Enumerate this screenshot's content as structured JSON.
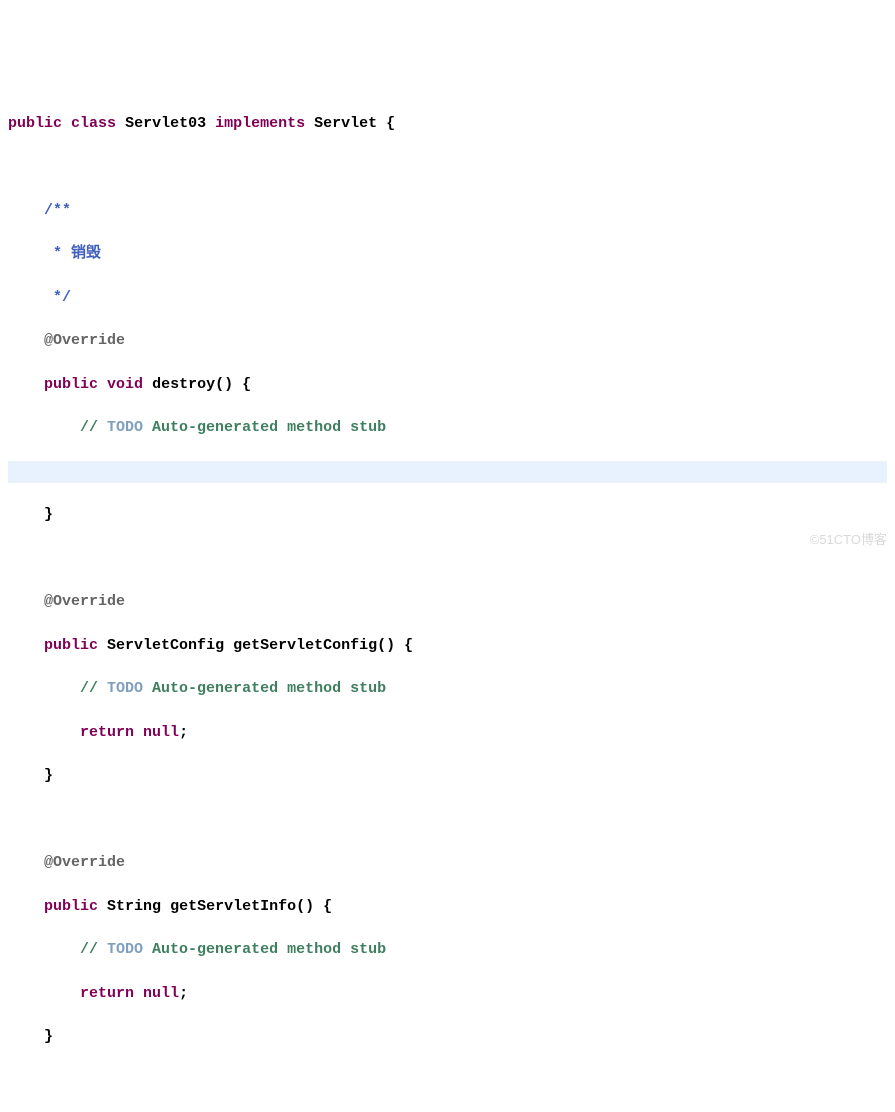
{
  "code": {
    "class_decl": {
      "kw_public": "public",
      "kw_class": "class",
      "class_name": "Servlet03",
      "kw_implements": "implements",
      "interface_name": "Servlet",
      "open_brace": " {"
    },
    "doc1": {
      "l1": "/**",
      "l2": " * 销毁",
      "l3": " */"
    },
    "override1": "@Override",
    "m1": {
      "kw_public": "public",
      "kw_void": "void",
      "name": "destroy",
      "parens": "()",
      "open": " {",
      "todo_prefix": "// ",
      "todo_kw": "TODO",
      "todo_rest": " Auto-generated method stub",
      "close": "}"
    },
    "override2": "@Override",
    "m2": {
      "kw_public": "public",
      "ret_type": "ServletConfig",
      "name": "getServletConfig",
      "parens": "()",
      "open": " {",
      "todo_prefix": "// ",
      "todo_kw": "TODO",
      "todo_rest": " Auto-generated method stub",
      "kw_return": "return",
      "kw_null": "null",
      "semi": ";",
      "close": "}"
    },
    "override3": "@Override",
    "m3": {
      "kw_public": "public",
      "ret_type": "String",
      "name": "getServletInfo",
      "parens": "()",
      "open": " {",
      "todo_prefix": "// ",
      "todo_kw": "TODO",
      "todo_rest": " Auto-generated method stub",
      "kw_return": "return",
      "kw_null": "null",
      "semi": ";",
      "close": "}"
    }
  },
  "watermark": "©51CTO博客"
}
